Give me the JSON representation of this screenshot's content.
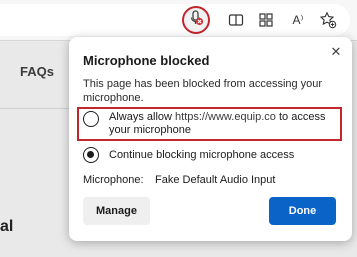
{
  "toolbar": {
    "icons": [
      "microphone-blocked-icon",
      "split-screen-icon",
      "apps-icon",
      "read-aloud-icon",
      "favorites-icon"
    ],
    "read_aloud_glyph": "A⁾"
  },
  "page": {
    "faqs_label": "FAQs",
    "fragment_text": "al"
  },
  "popup": {
    "title": "Microphone blocked",
    "description": "This page has been blocked from accessing your microphone.",
    "option_allow_prefix": "Always allow ",
    "option_allow_url": "https://www.equip.co",
    "option_allow_suffix": " to access your microphone",
    "option_block": "Continue blocking microphone access",
    "selected_option": "block",
    "microphone_label": "Microphone:",
    "microphone_value": "Fake Default Audio Input",
    "manage_label": "Manage",
    "done_label": "Done",
    "close_glyph": "✕"
  },
  "colors": {
    "highlight": "#c4262e",
    "primary_button": "#0a64c8",
    "toolbar_bg": "#f7f7f7",
    "page_bg": "#e9e9e9"
  }
}
